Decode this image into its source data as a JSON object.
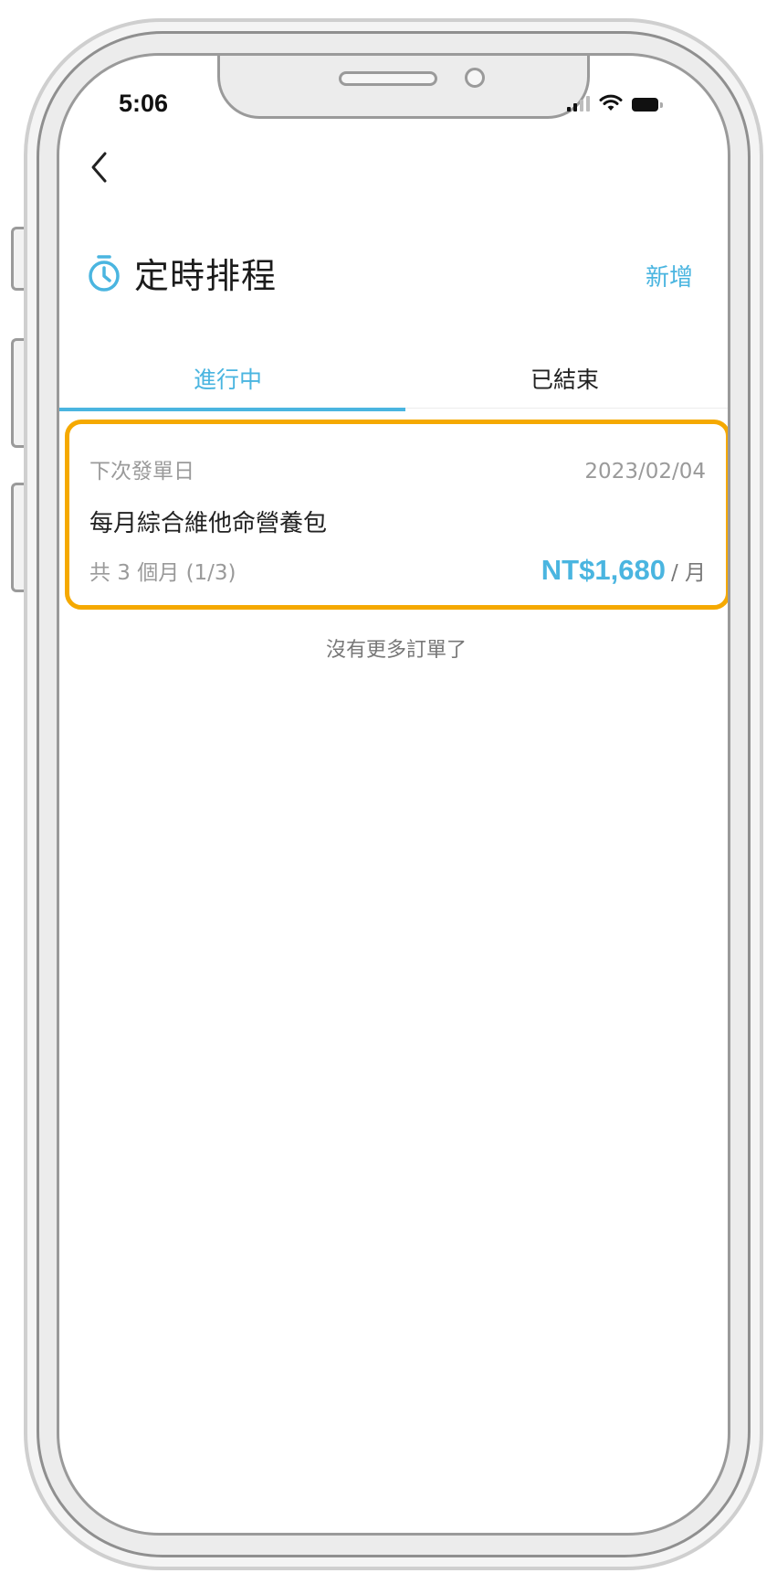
{
  "status_bar": {
    "time": "5:06"
  },
  "header": {
    "title": "定時排程",
    "add_label": "新增"
  },
  "tabs": [
    {
      "label": "進行中",
      "active": true
    },
    {
      "label": "已結束",
      "active": false
    }
  ],
  "order": {
    "next_date_label": "下次發單日",
    "next_date": "2023/02/04",
    "product_name": "每月綜合維他命營養包",
    "period_text": "共 3 個月 (1/3)",
    "price": "NT$1,680",
    "unit": "/ 月"
  },
  "footer_note": "沒有更多訂單了",
  "colors": {
    "accent": "#4ab5e0",
    "highlight_border": "#f5a900"
  }
}
